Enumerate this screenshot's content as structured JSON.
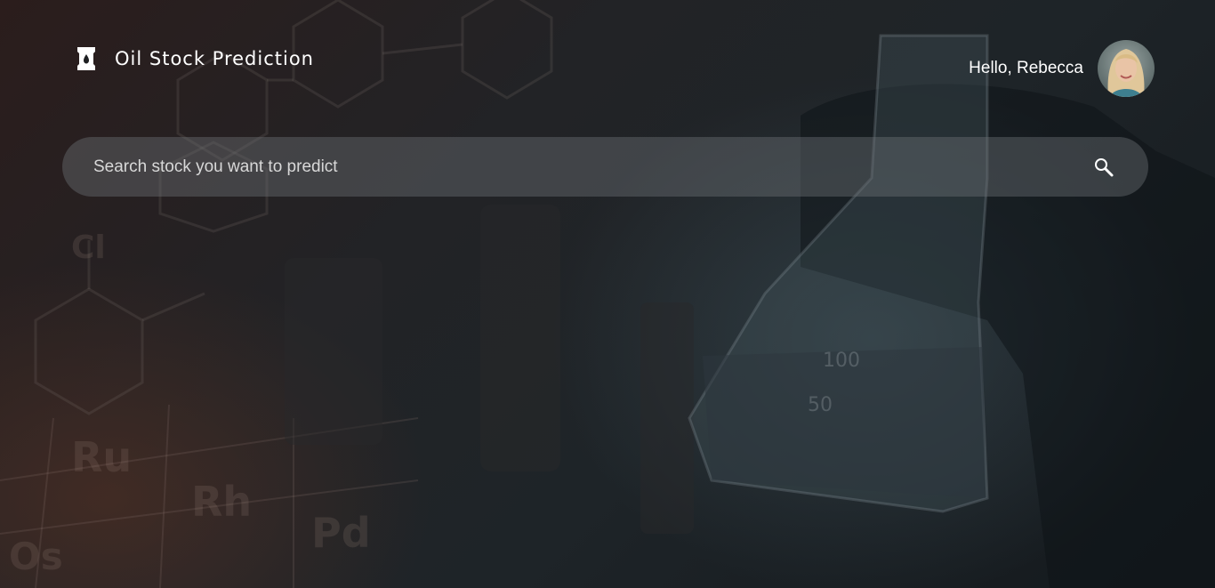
{
  "header": {
    "brand": "Oil Stock Prediction",
    "logo_icon": "oil-barrel-icon"
  },
  "user": {
    "greeting": "Hello, Rebecca",
    "avatar_icon": "user-avatar"
  },
  "search": {
    "placeholder": "Search stock you want to predict",
    "value": "",
    "icon": "search-icon"
  },
  "background": {
    "theme": "chemistry-lab-photo",
    "overlay_color": "#1a1c20"
  }
}
